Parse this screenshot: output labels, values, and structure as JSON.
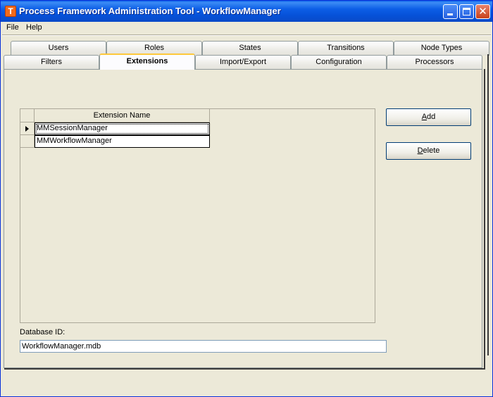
{
  "window": {
    "title": "Process Framework Administration Tool - WorkflowManager",
    "app_icon_letter": "T",
    "close_glyph": "✕"
  },
  "menu": {
    "items": [
      "File",
      "Help"
    ]
  },
  "tabs": {
    "row_back": [
      "Users",
      "Roles",
      "States",
      "Transitions",
      "Node Types"
    ],
    "row_front": [
      "Filters",
      "Extensions",
      "Import/Export",
      "Configuration",
      "Processors"
    ],
    "active": "Extensions"
  },
  "grid": {
    "column_header": "Extension Name",
    "rows": [
      "MMSessionManager",
      "MMWorkflowManager"
    ],
    "selected_row": 0
  },
  "buttons": {
    "add_label": "Add",
    "add_mnemonic": "A",
    "delete_label": "Delete",
    "delete_mnemonic": "D"
  },
  "database": {
    "label": "Database ID:",
    "value": "WorkflowManager.mdb"
  },
  "colors": {
    "titlebar": "#0a5ee8",
    "face": "#ece9d8",
    "active_tab_accent": "#ffc83c"
  }
}
